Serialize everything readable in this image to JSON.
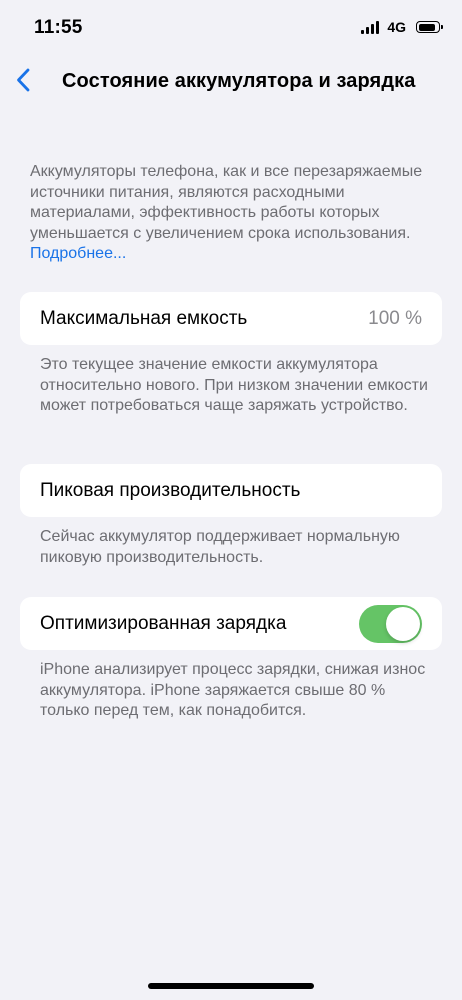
{
  "status_bar": {
    "time": "11:55",
    "network": "4G",
    "battery_level": 0.85
  },
  "nav": {
    "title": "Состояние аккумулятора и зарядка"
  },
  "intro": {
    "text": "Аккумуляторы телефона, как и все перезаряжаемые источники питания, являются расходными материалами, эффективность работы которых уменьшается с увеличением срока использования. ",
    "link_label": "Подробнее..."
  },
  "max_capacity": {
    "label": "Максимальная емкость",
    "value": "100 %",
    "footnote": "Это текущее значение емкости аккумулятора относительно нового. При низком значении емкости может потребоваться чаще заряжать устройство."
  },
  "peak_performance": {
    "label": "Пиковая производительность",
    "footnote": "Сейчас аккумулятор поддерживает нормальную пиковую производительность."
  },
  "optimized_charging": {
    "label": "Оптимизированная зарядка",
    "enabled": true,
    "footnote": "iPhone анализирует процесс зарядки, снижая износ аккумулятора. iPhone заряжается свыше 80 % только перед тем, как понадобится."
  },
  "colors": {
    "accent": "#1a73e8",
    "toggle_on": "#65c466",
    "background": "#f2f2f7"
  }
}
